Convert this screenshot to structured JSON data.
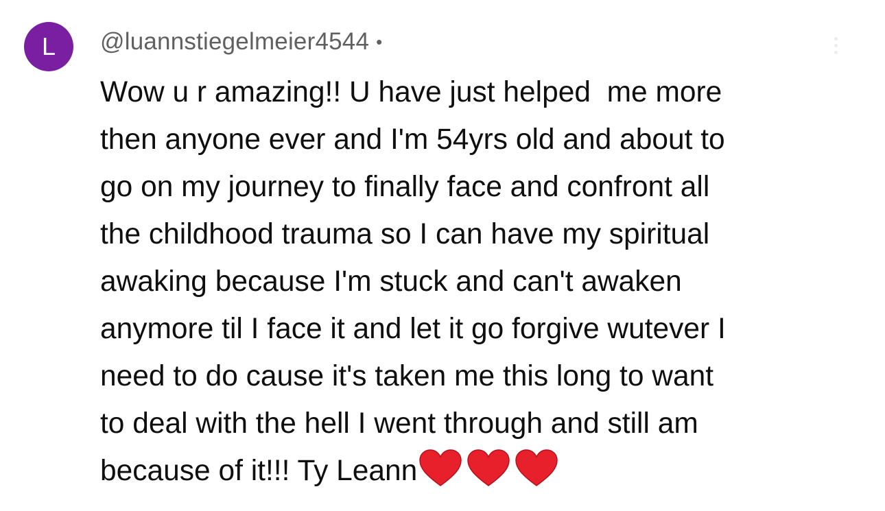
{
  "comment": {
    "avatar_letter": "L",
    "avatar_color": "#7b1fa2",
    "author_handle": "@luannstiegelmeier4544",
    "separator": "•",
    "text_lines": [
      "Wow u r amazing!! U have just helped  me more",
      "then anyone ever and I'm 54yrs old and about to",
      "go on my journey to finally face and confront all",
      "the childhood trauma so I can have my spiritual",
      "awaking because I'm stuck and can't awaken",
      "anymore til I face it and let it go forgive wutever I",
      "need to do cause it's taken me this long to want",
      "to deal with the hell I went through and still am",
      "because of it!!! Ty Leann"
    ],
    "trailing_emoji": [
      "red-heart-icon",
      "red-heart-icon",
      "red-heart-icon"
    ],
    "heart_color": "#e8202c"
  },
  "menu": {
    "icon": "more-vert-icon"
  }
}
